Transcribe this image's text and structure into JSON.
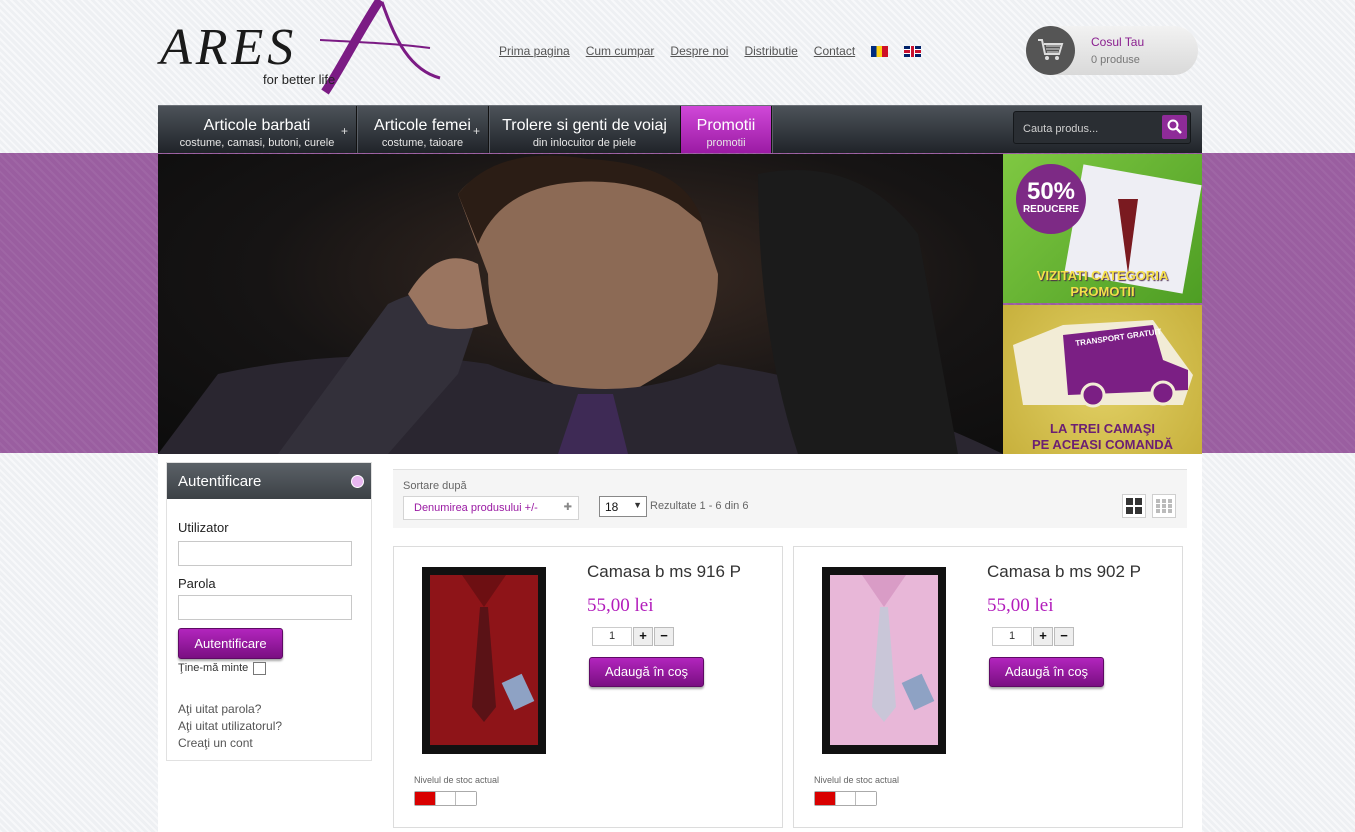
{
  "header": {
    "logo_text": "ARES",
    "tagline": "for better life",
    "links": [
      "Prima pagina",
      "Cum cumpar",
      "Despre noi",
      "Distributie",
      "Contact"
    ],
    "cart": {
      "title": "Cosul Tau",
      "count": "0 produse"
    }
  },
  "nav": {
    "items": [
      {
        "title": "Articole barbati",
        "subtitle": "costume, camasi, butoni, curele"
      },
      {
        "title": "Articole femei",
        "subtitle": "costume, taioare"
      },
      {
        "title": "Trolere si genti de voiaj",
        "subtitle": "din inlocuitor de piele"
      },
      {
        "title": "Promotii",
        "subtitle": "promotii"
      }
    ],
    "search_placeholder": "Cauta produs..."
  },
  "banner": {
    "promo1": {
      "badge_big": "50%",
      "badge_small": "REDUCERE",
      "text_line1": "VIZITATI CATEGORIA",
      "text_line2": "PROMOTII"
    },
    "promo2": {
      "truck_text": "TRANSPORT GRATUIT",
      "text_line1": "LA TREI CAMAŞI",
      "text_line2": "PE ACEASI COMANDĂ"
    }
  },
  "login": {
    "title": "Autentificare",
    "user_label": "Utilizator",
    "pass_label": "Parola",
    "button": "Autentificare",
    "remember": "Ţine-mă minte",
    "links": [
      "Aţi uitat parola?",
      "Aţi uitat utilizatorul?",
      "Creaţi un cont"
    ]
  },
  "sort": {
    "label": "Sortare după",
    "selected": "Denumirea produsului +/-",
    "limit": "18",
    "results": "Rezultate 1 - 6 din 6"
  },
  "products": [
    {
      "name": "Camasa b ms 916 P",
      "price": "55,00 lei",
      "qty": "1",
      "button": "Adaugă în coş",
      "stock_label": "Nivelul de stoc actual",
      "stock_level": 0.33,
      "shirt_color": "#8e1418",
      "tie_color": "#5a1216"
    },
    {
      "name": "Camasa b ms 902 P",
      "price": "55,00 lei",
      "qty": "1",
      "button": "Adaugă în coş",
      "stock_label": "Nivelul de stoc actual",
      "stock_level": 0.33,
      "shirt_color": "#e8b7d8",
      "tie_color": "#c9c6d8"
    }
  ],
  "colors": {
    "accent": "#9a1aa3",
    "band": "#9a5ea0",
    "stock_red": "#d90000"
  }
}
